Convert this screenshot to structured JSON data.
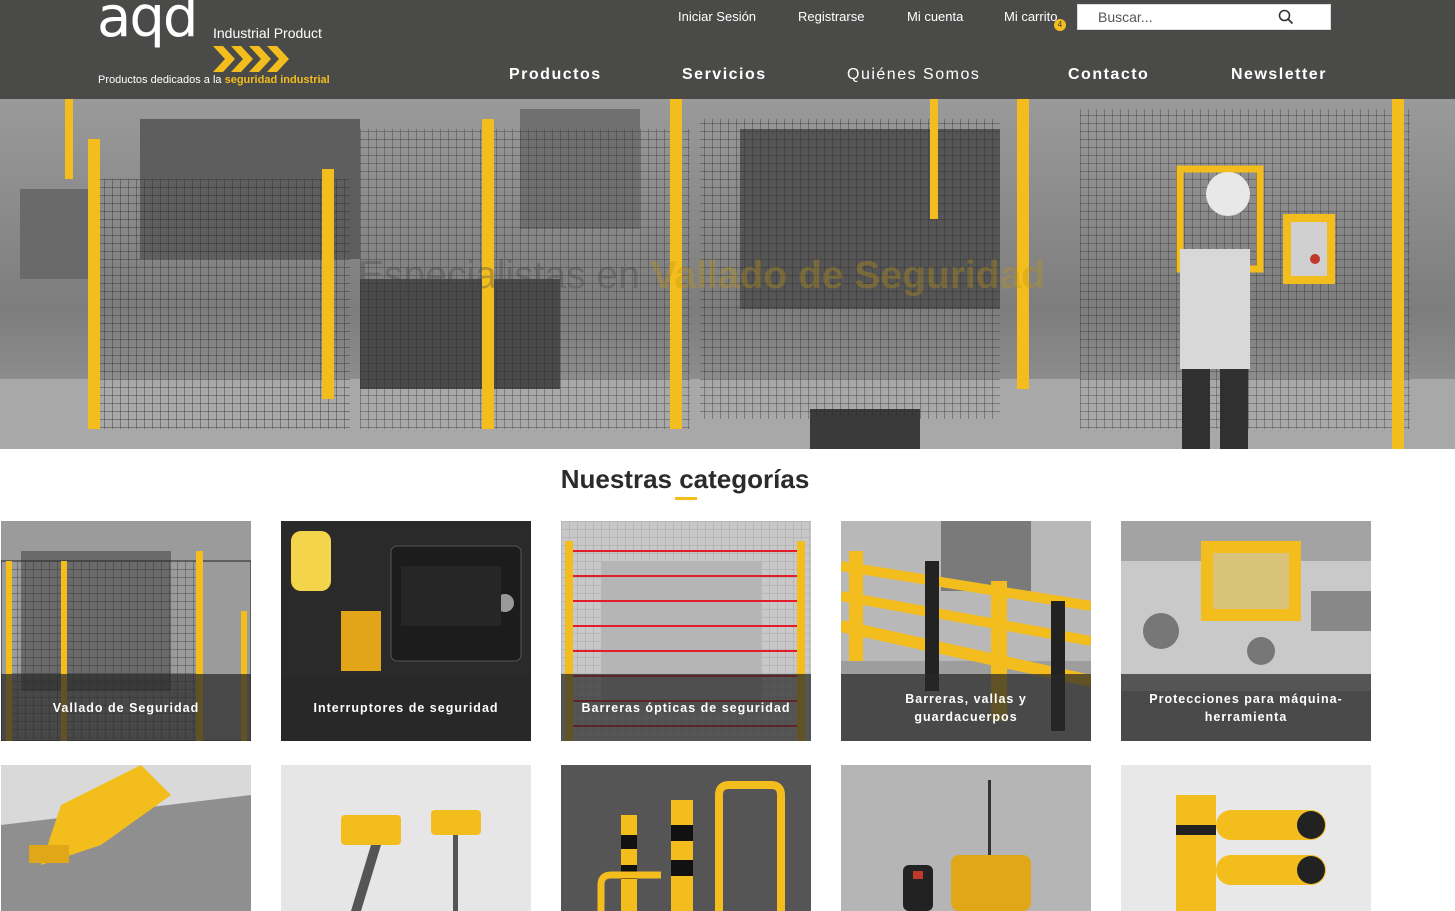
{
  "header": {
    "logo": {
      "brand": "aqd",
      "product": "Industrial Product",
      "tagline_prefix": "Productos dedicados a la ",
      "tagline_highlight": "seguridad industrial"
    },
    "top_links": {
      "login": "Iniciar Sesión",
      "register": "Registrarse",
      "account": "Mi cuenta",
      "cart": "Mi carrito",
      "cart_count": "4"
    },
    "search": {
      "placeholder": "Buscar..."
    },
    "nav": {
      "products": "Productos",
      "services": "Servicios",
      "about": "Quiénes Somos",
      "contact": "Contacto",
      "newsletter": "Newsletter"
    }
  },
  "hero": {
    "text_prefix": "Especialistas en ",
    "text_highlight": "Vallado de Seguridad"
  },
  "categories": {
    "title": "Nuestras categorías",
    "items": [
      {
        "label": "Vallado de Seguridad"
      },
      {
        "label": "Interruptores de seguridad"
      },
      {
        "label": "Barreras ópticas de seguridad"
      },
      {
        "label": "Barreras, vallas y guardacuerpos"
      },
      {
        "label": "Protecciones para máquina-herramienta"
      }
    ]
  },
  "colors": {
    "header_bg": "#4a4a48",
    "accent": "#f3bd1e",
    "text_dark": "#2b2b2b"
  },
  "icons": [
    "search-icon",
    "chevron-arrows-icon"
  ]
}
